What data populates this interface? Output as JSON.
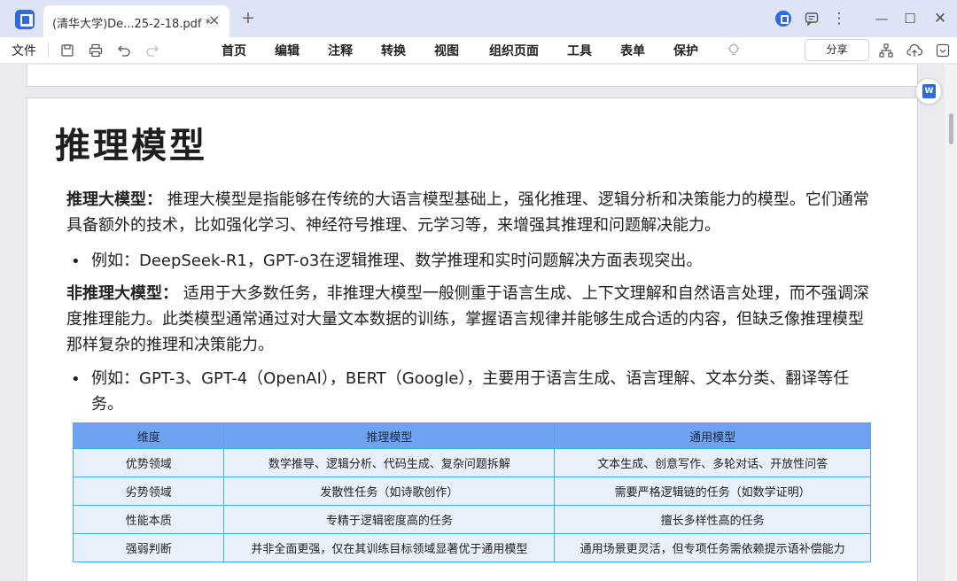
{
  "window": {
    "tab_title": "(清华大学)De...25-2-18.pdf *",
    "tab_close": "×",
    "tab_add": "+",
    "icons": [
      "app-logo-icon",
      "account-icon",
      "feedback-icon",
      "more-icon",
      "minimize-icon",
      "maximize-icon",
      "close-icon"
    ],
    "more_glyph": "⋮",
    "min_glyph": "—",
    "max_glyph": "☐",
    "close_glyph": "✕"
  },
  "menubar": {
    "file_label": "文件",
    "items": [
      "首页",
      "编辑",
      "注释",
      "转换",
      "视图",
      "组织页面",
      "工具",
      "表单",
      "保护"
    ],
    "share_label": "分享",
    "quick_icons": [
      "save-icon",
      "print-icon",
      "undo-icon",
      "redo-icon"
    ],
    "right_icons": [
      "flow-icon",
      "cloud-upload-icon",
      "collapse-icon"
    ]
  },
  "document": {
    "heading": "推理模型",
    "p1_label": "推理大模型：",
    "p1_text": " 推理大模型是指能够在传统的大语言模型基础上，强化推理、逻辑分析和决策能力的模型。它们通常具备额外的技术，比如强化学习、神经符号推理、元学习等，来增强其推理和问题解决能力。",
    "b1": "例如：DeepSeek-R1，GPT-o3在逻辑推理、数学推理和实时问题解决方面表现突出。",
    "p2_label": "非推理大模型：",
    "p2_text": " 适用于大多数任务，非推理大模型一般侧重于语言生成、上下文理解和自然语言处理，而不强调深度推理能力。此类模型通常通过对大量文本数据的训练，掌握语言规律并能够生成合适的内容，但缺乏像推理模型那样复杂的推理和决策能力。",
    "b2": "例如：GPT-3、GPT-4（OpenAI），BERT（Google），主要用于语言生成、语言理解、文本分类、翻译等任务。",
    "bullet_glyph": "•",
    "table": {
      "headers": [
        "维度",
        "推理模型",
        "通用模型"
      ],
      "rows": [
        [
          "优势领域",
          "数学推导、逻辑分析、代码生成、复杂问题拆解",
          "文本生成、创意写作、多轮对话、开放性问答"
        ],
        [
          "劣势领域",
          "发散性任务（如诗歌创作）",
          "需要严格逻辑链的任务（如数学证明）"
        ],
        [
          "性能本质",
          "专精于逻辑密度高的任务",
          "擅长多样性高的任务"
        ],
        [
          "强弱判断",
          "并非全面更强，仅在其训练目标领域显著优于通用模型",
          "通用场景更灵活，但专项任务需依赖提示语补偿能力"
        ]
      ]
    }
  },
  "colors": {
    "titlebar_bg": "#dde4f5",
    "accent": "#2f6ae6",
    "table_header_bg": "#6fa2f0",
    "table_cell_bg": "#e8f0fb",
    "table_border": "#4ea8e6"
  }
}
